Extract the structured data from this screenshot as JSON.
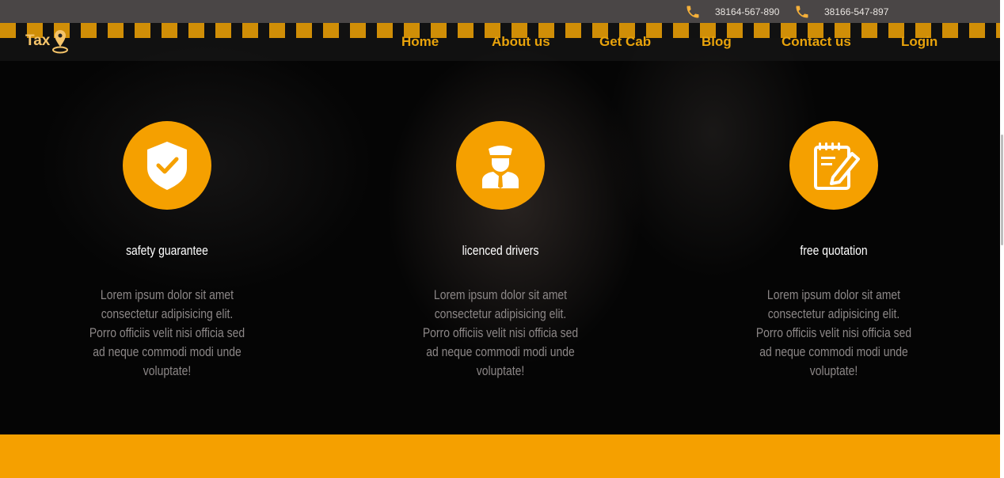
{
  "topbar": {
    "phones": [
      {
        "number": "38164-567-890",
        "icon": "phone-icon"
      },
      {
        "number": "38166-547-897",
        "icon": "phone-icon"
      }
    ]
  },
  "brand": {
    "logo_text": "Tax",
    "logo_icon": "map-pin-icon"
  },
  "nav": {
    "items": [
      "Home",
      "About us",
      "Get Cab",
      "Blog",
      "Contact us",
      "Login"
    ]
  },
  "features": [
    {
      "icon": "shield-check-icon",
      "title": "safety guarantee",
      "description": "Lorem ipsum dolor sit amet consectetur adipisicing elit. Porro officiis velit nisi officia sed ad neque commodi modi unde voluptate!"
    },
    {
      "icon": "driver-icon",
      "title": "licenced drivers",
      "description": "Lorem ipsum dolor sit amet consectetur adipisicing elit. Porro officiis velit nisi officia sed ad neque commodi modi unde voluptate!"
    },
    {
      "icon": "notepad-pencil-icon",
      "title": "free quotation",
      "description": "Lorem ipsum dolor sit amet consectetur adipisicing elit. Porro officiis velit nisi officia sed ad neque commodi modi unde voluptate!"
    }
  ],
  "colors": {
    "accent": "#f5a000",
    "nav_text": "#e9a30b",
    "topbar_bg": "#4a4646"
  }
}
